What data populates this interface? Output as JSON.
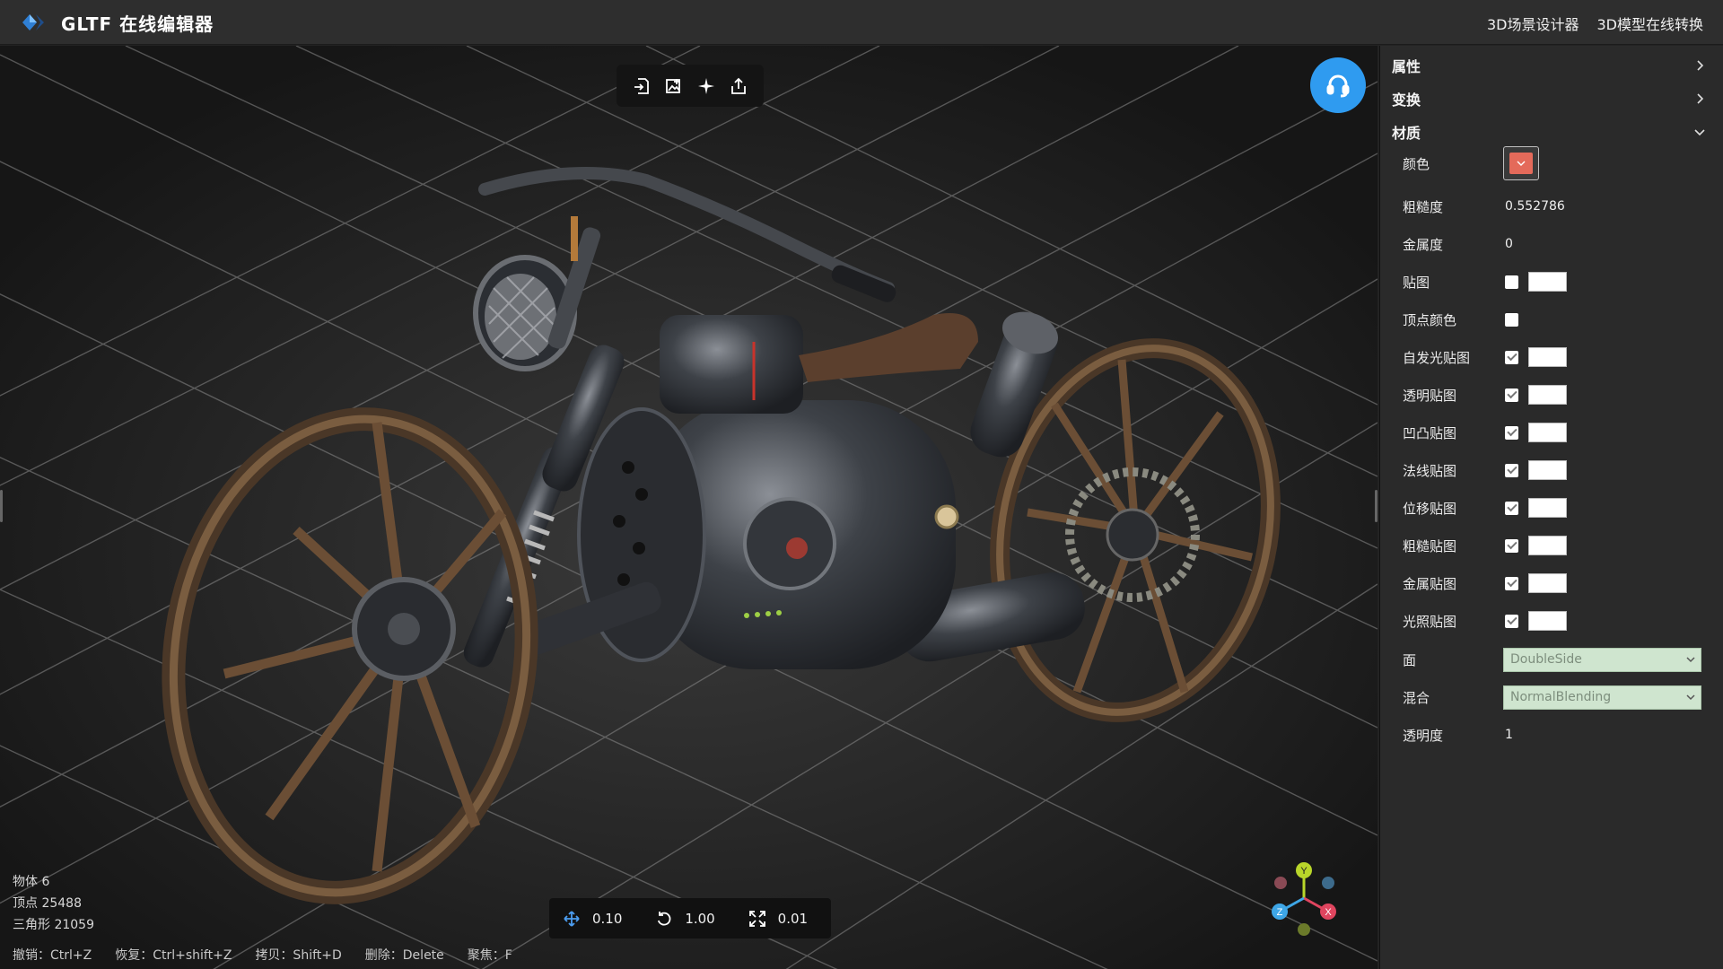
{
  "app": {
    "title": "GLTF 在线编辑器",
    "nav": [
      "3D场景设计器",
      "3D模型在线转换"
    ]
  },
  "viewport_toolbar": {
    "buttons": [
      "import-icon",
      "import-image-icon",
      "light-icon",
      "export-icon"
    ]
  },
  "stats": {
    "objects": "物体 6",
    "vertices": "顶点 25488",
    "triangles": "三角形 21059"
  },
  "shortcuts": [
    "撤销：Ctrl+Z",
    "恢复：Ctrl+shift+Z",
    "拷贝：Shift+D",
    "删除：Delete",
    "聚焦：F"
  ],
  "snap": {
    "translate": "0.10",
    "rotate": "1.00",
    "scale": "0.01"
  },
  "gizmo": {
    "labels": {
      "x": "X",
      "y": "Y",
      "z": "Z"
    },
    "colors": {
      "x": "#e0455f",
      "y": "#b9d62a",
      "z": "#3ea6e6"
    }
  },
  "panel": {
    "sections": [
      {
        "label": "属性",
        "expanded": false
      },
      {
        "label": "变换",
        "expanded": false
      },
      {
        "label": "材质",
        "expanded": true
      }
    ],
    "material": {
      "color_label": "颜色",
      "color_value": "#e46a5a",
      "roughness_label": "粗糙度",
      "roughness": "0.552786",
      "metalness_label": "金属度",
      "metalness": "0",
      "map_rows": [
        {
          "label": "贴图",
          "checked": false,
          "slot": true
        },
        {
          "label": "顶点颜色",
          "checked": false,
          "slot": false
        },
        {
          "label": "自发光贴图",
          "checked": true,
          "slot": true
        },
        {
          "label": "透明贴图",
          "checked": true,
          "slot": true
        },
        {
          "label": "凹凸贴图",
          "checked": true,
          "slot": true
        },
        {
          "label": "法线贴图",
          "checked": true,
          "slot": true
        },
        {
          "label": "位移贴图",
          "checked": true,
          "slot": true
        },
        {
          "label": "粗糙贴图",
          "checked": true,
          "slot": true
        },
        {
          "label": "金属贴图",
          "checked": true,
          "slot": true
        },
        {
          "label": "光照贴图",
          "checked": true,
          "slot": true
        }
      ],
      "side_label": "面",
      "side_value": "DoubleSide",
      "blend_label": "混合",
      "blend_value": "NormalBlending",
      "opacity_label": "透明度",
      "opacity": "1"
    }
  },
  "colors": {
    "accent": "#2f9bf0",
    "topbar": "#2e2e2e",
    "panel": "#2a2a2a",
    "viewport": "#1a1a1a"
  }
}
